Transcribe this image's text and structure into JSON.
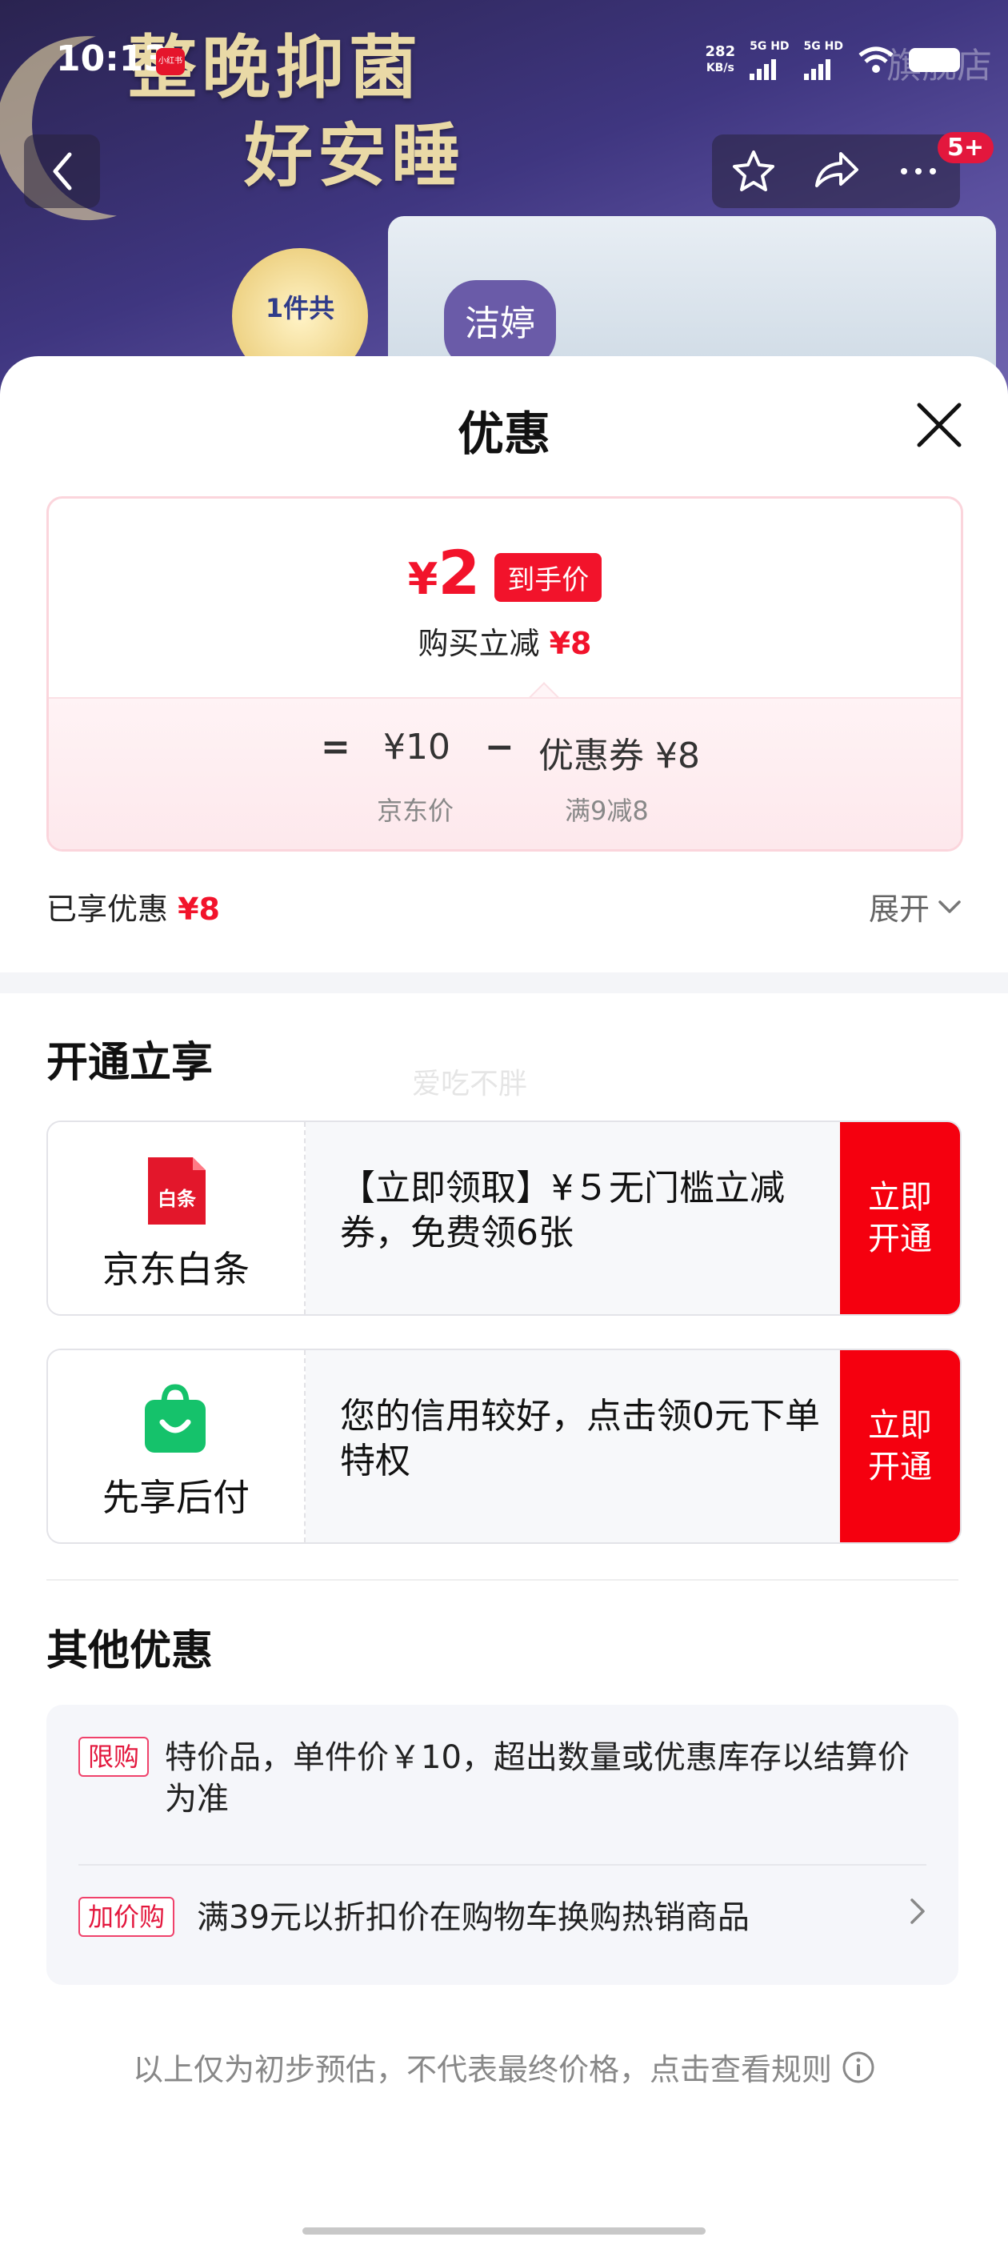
{
  "status_bar": {
    "time": "10:13",
    "app_icon_text": "小红书",
    "net_speed_value": "282",
    "net_speed_unit": "KB/s",
    "sim1_label": "5G HD",
    "sim2_label": "5G HD",
    "shop_name_partial": "旗舰店"
  },
  "banner": {
    "headline_line1": "整晚抑菌",
    "headline_line2": "好安睡",
    "badge_text": "1件共",
    "brand_text": "洁婷"
  },
  "nav": {
    "cart_badge": "5+"
  },
  "sheet": {
    "title": "优惠",
    "final_price_symbol": "¥",
    "final_price": "2",
    "final_price_tag": "到手价",
    "reduce_label": "购买立减",
    "reduce_amount": "¥8",
    "formula": {
      "equals": "=",
      "base_price": "¥10",
      "minus": "−",
      "coupon": "优惠券 ¥8",
      "base_label": "京东价",
      "coupon_label": "满9减8"
    },
    "enjoyed_label": "已享优惠",
    "enjoyed_amount": "¥8",
    "expand_label": "展开"
  },
  "open_section": {
    "title": "开通立享",
    "watermark": "爱吃不胖",
    "cards": [
      {
        "logo_text": "白条",
        "name": "京东白条",
        "desc": "【立即领取】¥５无门槛立减券，免费领6张",
        "button_line1": "立即",
        "button_line2": "开通"
      },
      {
        "name": "先享后付",
        "desc": "您的信用较好，点击领0元下单特权",
        "button_line1": "立即",
        "button_line2": "开通"
      }
    ]
  },
  "other_section": {
    "title": "其他优惠",
    "items": [
      {
        "tag": "限购",
        "text": "特价品，单件价￥10，超出数量或优惠库存以结算价为准"
      },
      {
        "tag": "加价购",
        "text": "满39元以折扣价在购物车换购热销商品"
      }
    ]
  },
  "footnote": "以上仅为初步预估，不代表最终价格，点击查看规则",
  "colors": {
    "accent_red": "#f2132b",
    "button_red": "#f5000f",
    "green_logo": "#15c26b"
  }
}
